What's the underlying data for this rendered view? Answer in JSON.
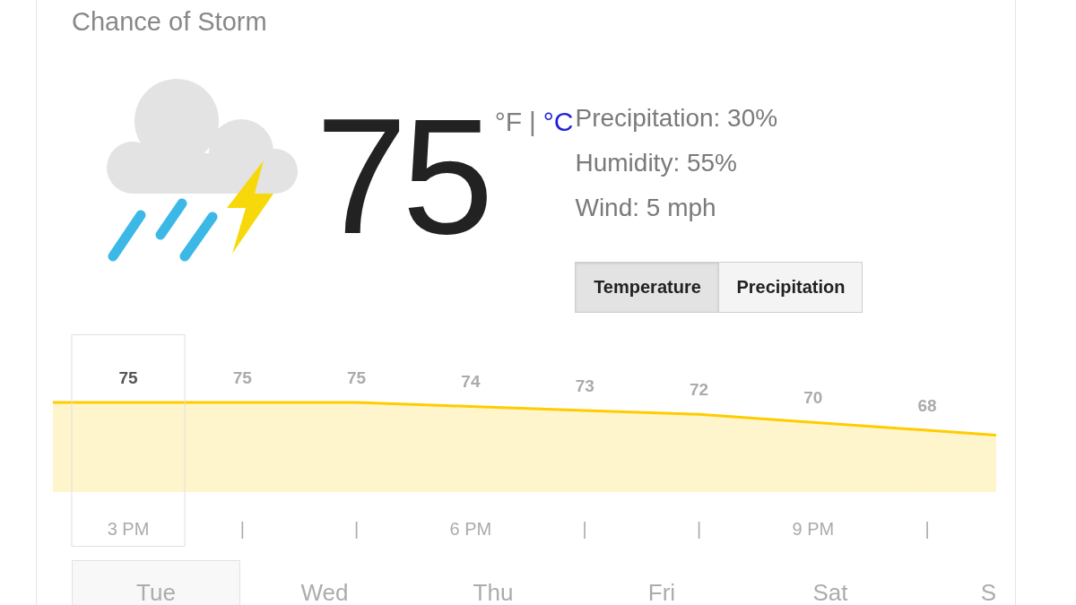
{
  "condition": "Chance of Storm",
  "current": {
    "temperature": "75",
    "units": {
      "options": [
        {
          "label": "°F",
          "selected": true
        },
        {
          "label": "°C",
          "selected": false
        }
      ],
      "separator": "|"
    }
  },
  "details": [
    "Precipitation: 30%",
    "Humidity: 55%",
    "Wind: 5 mph"
  ],
  "chart_tabs": [
    {
      "label": "Temperature",
      "selected": true
    },
    {
      "label": "Precipitation",
      "selected": false
    }
  ],
  "hourly": {
    "chart_data": {
      "type": "area",
      "categories": [
        "3 PM",
        "|",
        "|",
        "6 PM",
        "|",
        "|",
        "9 PM",
        "|"
      ],
      "series": [
        {
          "color": "#ffcc00",
          "values": [
            75,
            75,
            75,
            74,
            73,
            72,
            70,
            68
          ]
        }
      ],
      "data_labels": true
    },
    "hours": [
      {
        "selected": true
      },
      {
        "selected": false
      },
      {
        "selected": false
      },
      {
        "selected": false
      },
      {
        "selected": false
      },
      {
        "selected": false
      },
      {
        "selected": false
      },
      {
        "selected": false
      }
    ]
  },
  "days": [
    {
      "label": "Tue",
      "selected": true
    },
    {
      "label": "Wed",
      "selected": false
    },
    {
      "label": "Thu",
      "selected": false
    },
    {
      "label": "Fri",
      "selected": false
    },
    {
      "label": "Sat",
      "selected": false
    },
    {
      "label": "S",
      "selected": false
    }
  ]
}
